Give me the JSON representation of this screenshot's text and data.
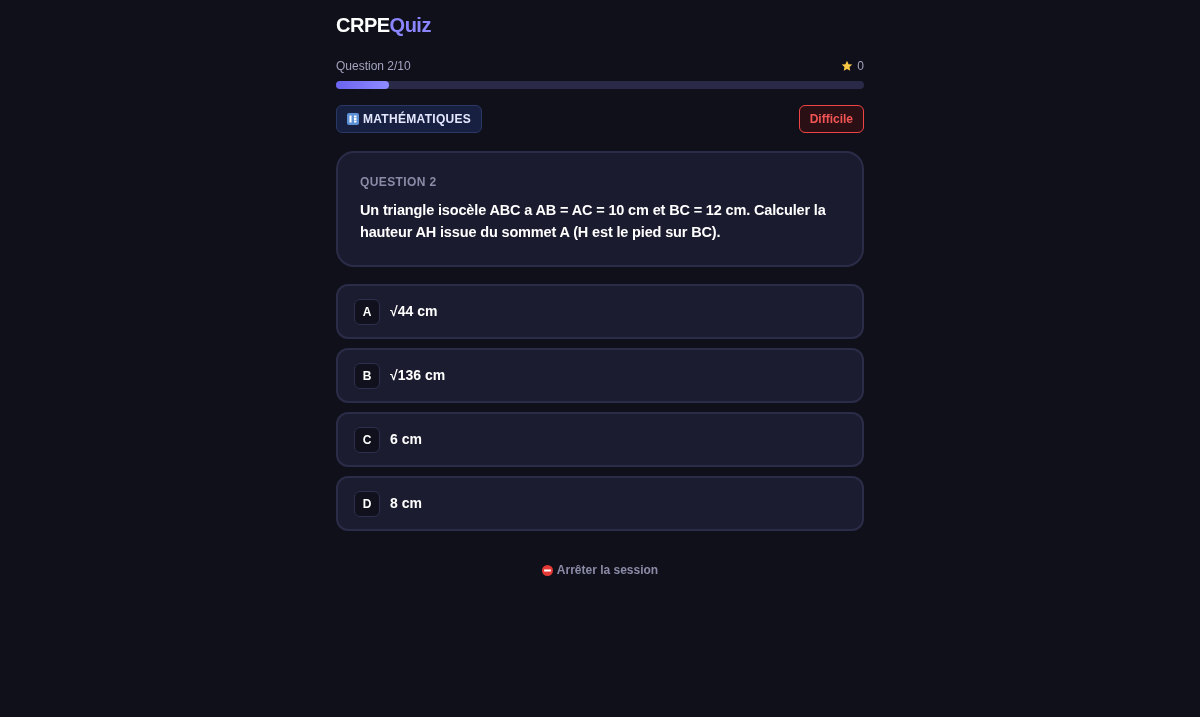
{
  "logo": {
    "text": "CRPE",
    "accent": "Quiz"
  },
  "progress": {
    "label": "Question 2/10",
    "level": 0.1,
    "score": "0"
  },
  "category": {
    "label": "MATHÉMATIQUES"
  },
  "difficulty": {
    "label": "Difficile"
  },
  "question": {
    "number": "QUESTION 2",
    "text": "Un triangle isocèle ABC a AB = AC = 10 cm et BC = 12 cm. Calculer la hauteur AH issue du sommet A (H est le pied sur BC)."
  },
  "options": [
    {
      "letter": "A",
      "text": "√44 cm",
      "selected": false
    },
    {
      "letter": "B",
      "text": "√136 cm",
      "selected": false
    },
    {
      "letter": "C",
      "text": "6 cm",
      "selected": false
    },
    {
      "letter": "D",
      "text": "8 cm",
      "selected": false
    }
  ],
  "stop_link": {
    "label": "Arrêter la session"
  }
}
